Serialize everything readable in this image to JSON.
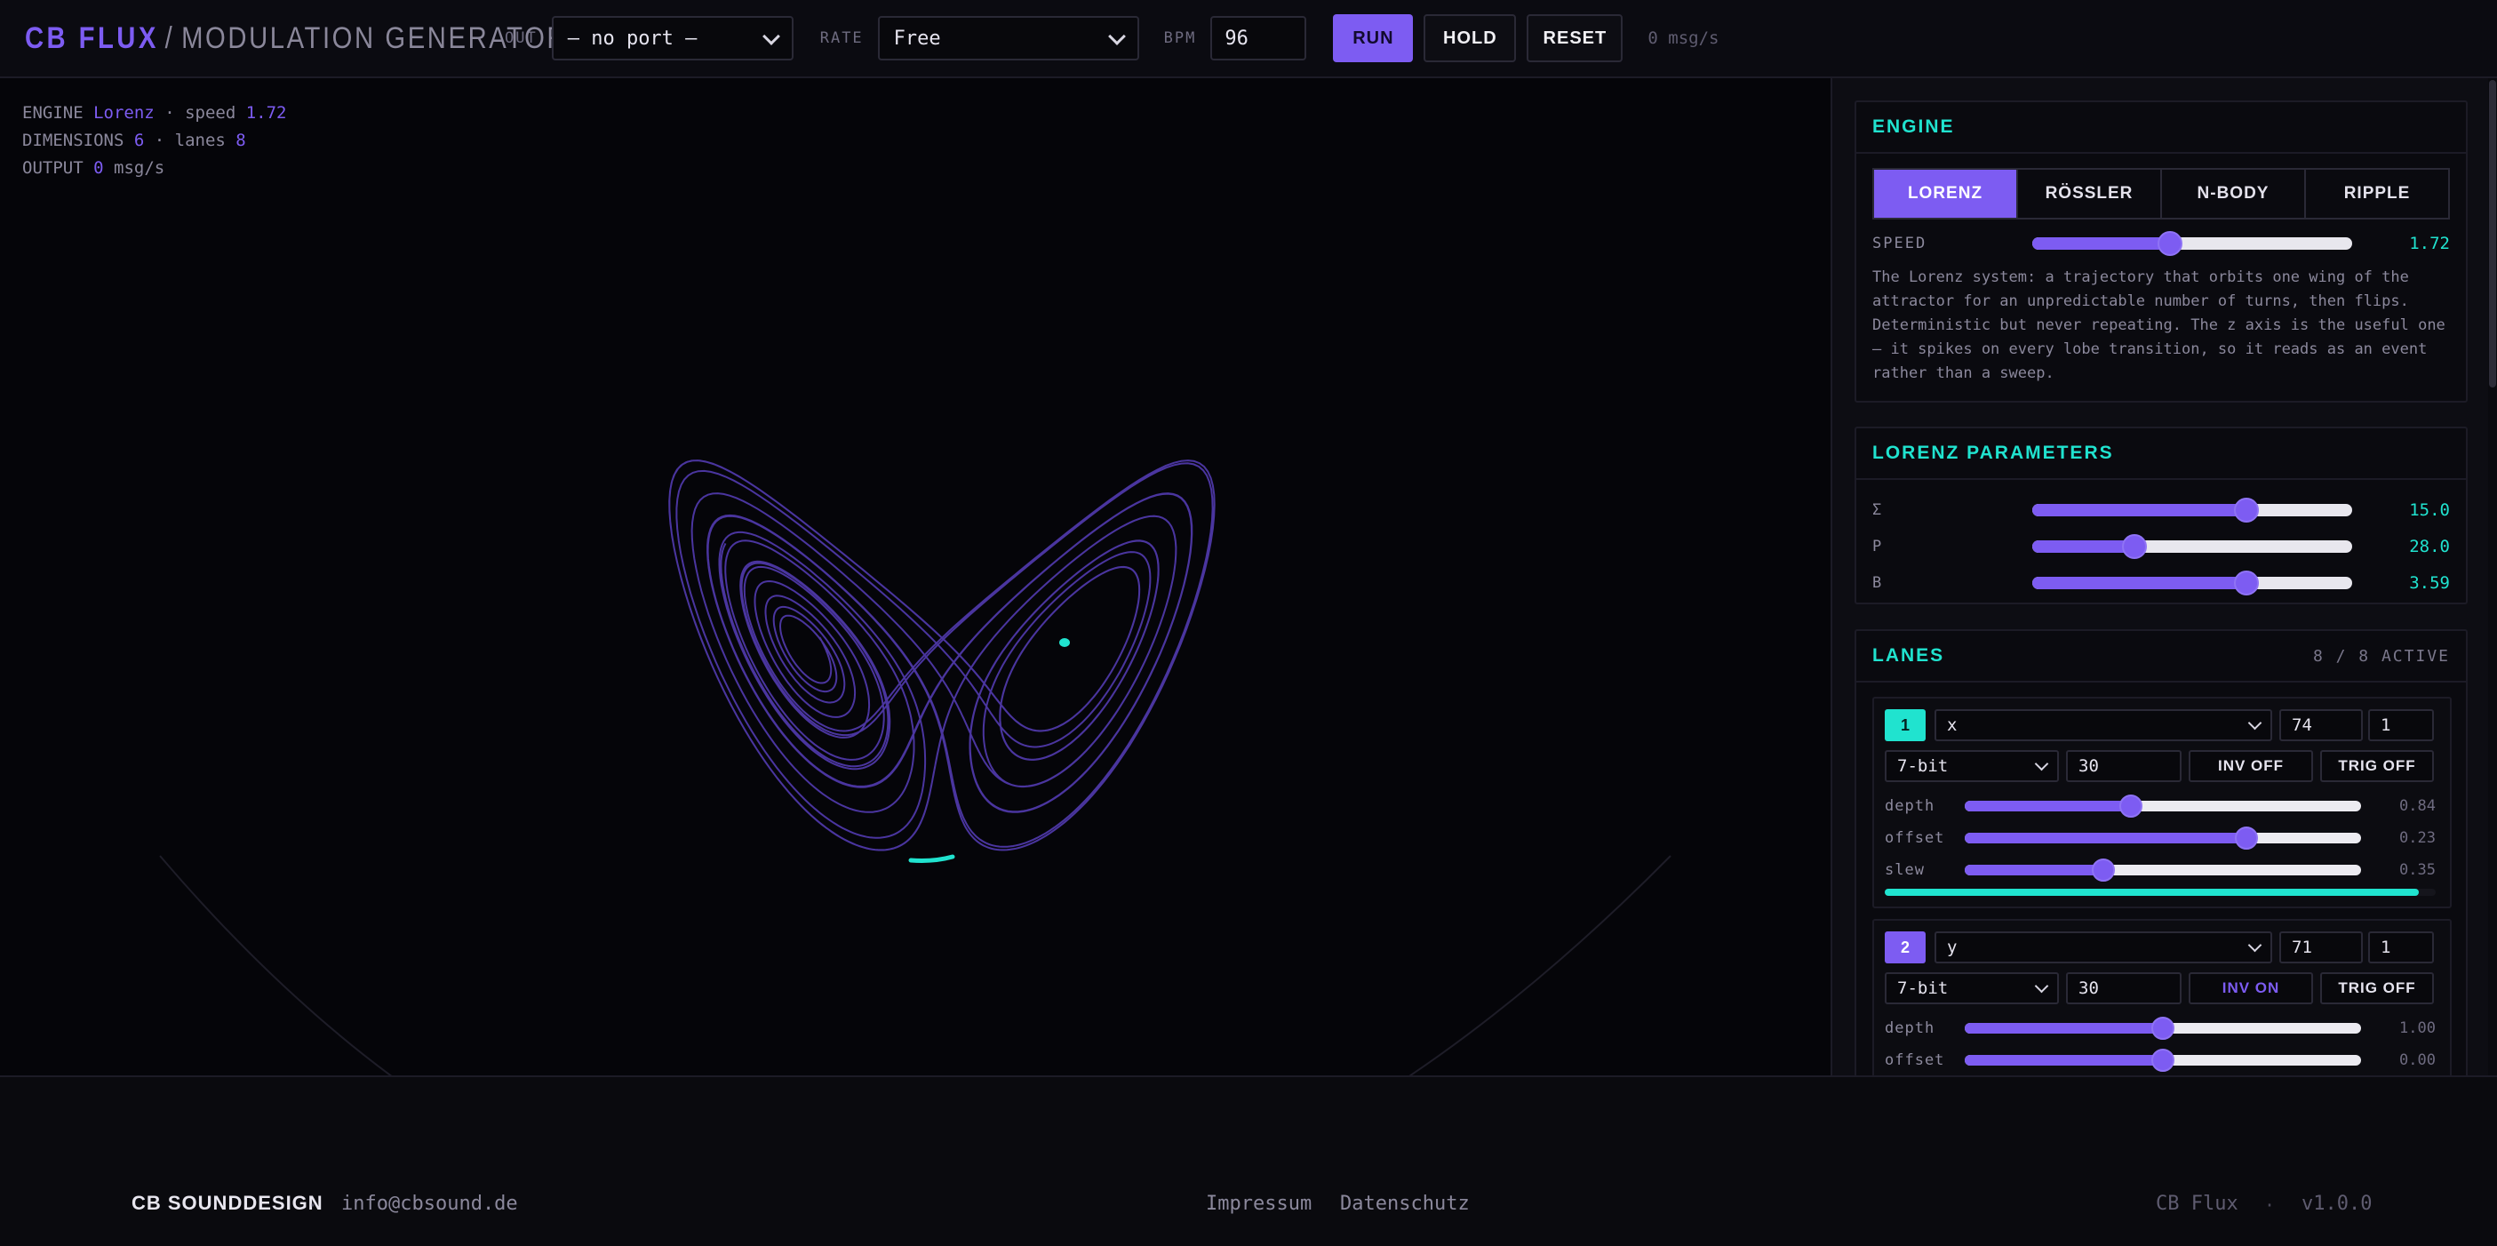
{
  "header": {
    "brand": "CB FLUX",
    "brand_sep": "/",
    "brand_sub": "MODULATION GENERATOR",
    "out_label": "OUT",
    "out_value": "— no port —",
    "rate_label": "RATE",
    "rate_value": "Free",
    "bpm_label": "BPM",
    "bpm_value": "96",
    "run_label": "RUN",
    "hold_label": "HOLD",
    "reset_label": "RESET",
    "rate_readout": "0 msg/s"
  },
  "stats": {
    "engine_label": "ENGINE",
    "engine_value": "Lorenz",
    "speed_label": "· speed",
    "speed_value": "1.72",
    "dimensions_label": "DIMENSIONS",
    "dimensions_value": "6",
    "lanes_label": "· lanes",
    "lanes_value": "8",
    "output_label": "OUTPUT",
    "output_value": "0",
    "output_unit": "msg/s"
  },
  "engine": {
    "title": "ENGINE",
    "tabs": [
      "LORENZ",
      "RÖSSLER",
      "N-BODY",
      "RIPPLE"
    ],
    "active_tab": "LORENZ",
    "speed_label": "SPEED",
    "speed_value": "1.72",
    "speed_level": 0.43,
    "description": "The Lorenz system: a trajectory that orbits one wing of the attractor for an unpredictable number of turns, then flips. Deterministic but never repeating. The z axis is the useful one — it spikes on every lobe transition, so it reads as an event rather than a sweep."
  },
  "params": {
    "title": "LORENZ PARAMETERS",
    "items": [
      {
        "label": "Σ",
        "value": "15.0",
        "level": 0.67
      },
      {
        "label": "Ρ",
        "value": "28.0",
        "level": 0.32
      },
      {
        "label": "Β",
        "value": "3.59",
        "level": 0.67
      }
    ]
  },
  "lanes": {
    "title": "LANES",
    "count": "8 / 8 ACTIVE",
    "items": [
      {
        "num": "1",
        "source": "x",
        "cc": "74",
        "channel": "1",
        "resolution": "7-bit",
        "rate": "30",
        "inv": "INV OFF",
        "trig": "TRIG OFF",
        "depth_label": "depth",
        "depth": "0.84",
        "depth_level": 0.42,
        "offset_label": "offset",
        "offset": "0.23",
        "offset_level": 0.71,
        "slew_label": "slew",
        "slew": "0.35",
        "slew_level": 0.35,
        "meter_level": 0.97
      },
      {
        "num": "2",
        "source": "y",
        "cc": "71",
        "channel": "1",
        "resolution": "7-bit",
        "rate": "30",
        "inv": "INV ON",
        "trig": "TRIG OFF",
        "depth_label": "depth",
        "depth": "1.00",
        "depth_level": 0.5,
        "offset_label": "offset",
        "offset": "0.00",
        "offset_level": 0.5
      }
    ]
  },
  "footer": {
    "brand": "CB SOUNDDESIGN",
    "dot": "·",
    "email": "info@cbsound.de",
    "impressum": "Impressum",
    "datenschutz": "Datenschutz",
    "product": "CB Flux",
    "version": "v1.0.0"
  },
  "colors": {
    "accent": "#7d5cf2",
    "highlight": "#20e3cf",
    "background": "#050509",
    "panel": "#0d0d13"
  }
}
